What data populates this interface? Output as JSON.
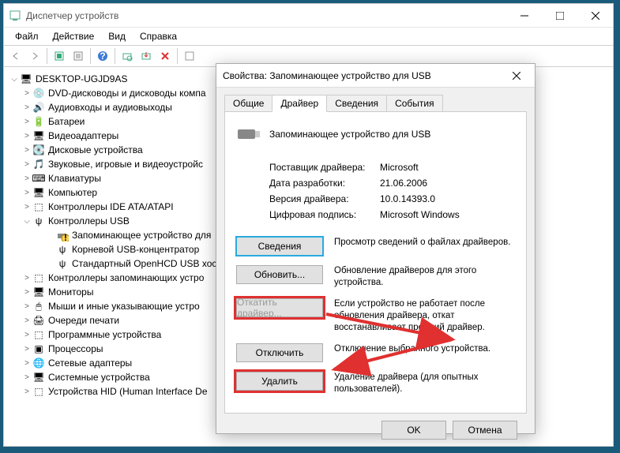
{
  "window": {
    "title": "Диспетчер устройств"
  },
  "menubar": {
    "file": "Файл",
    "action": "Действие",
    "view": "Вид",
    "help": "Справка"
  },
  "tree": {
    "root": "DESKTOP-UGJD9AS",
    "items": [
      "DVD-дисководы и дисководы компа",
      "Аудиовходы и аудиовыходы",
      "Батареи",
      "Видеоадаптеры",
      "Дисковые устройства",
      "Звуковые, игровые и видеоустройс",
      "Клавиатуры",
      "Компьютер",
      "Контроллеры IDE ATA/ATAPI",
      "Контроллеры USB",
      "Контроллеры запоминающих устро",
      "Мониторы",
      "Мыши и иные указывающие устро",
      "Очереди печати",
      "Программные устройства",
      "Процессоры",
      "Сетевые адаптеры",
      "Системные устройства",
      "Устройства HID (Human Interface De"
    ],
    "usb_children": [
      "Запоминающее устройство для",
      "Корневой USB-концентратор",
      "Стандартный OpenHCD USB хост"
    ]
  },
  "dialog": {
    "title": "Свойства: Запоминающее устройство для USB",
    "tabs": {
      "general": "Общие",
      "driver": "Драйвер",
      "details": "Сведения",
      "events": "События"
    },
    "device_name": "Запоминающее устройство для USB",
    "info": {
      "provider_k": "Поставщик драйвера:",
      "provider_v": "Microsoft",
      "date_k": "Дата разработки:",
      "date_v": "21.06.2006",
      "version_k": "Версия драйвера:",
      "version_v": "10.0.14393.0",
      "signature_k": "Цифровая подпись:",
      "signature_v": "Microsoft Windows"
    },
    "buttons": {
      "details": "Сведения",
      "update": "Обновить...",
      "rollback": "Откатить драйвер...",
      "disable": "Отключить",
      "uninstall": "Удалить"
    },
    "desc": {
      "details": "Просмотр сведений о файлах драйверов.",
      "update": "Обновление драйверов для этого устройства.",
      "rollback": "Если устройство не работает после обновления драйвера, откат восстанавливает прежний драйвер.",
      "disable": "Отключение выбранного устройства.",
      "uninstall": "Удаление драйвера (для опытных пользователей)."
    },
    "footer": {
      "ok": "OK",
      "cancel": "Отмена"
    }
  },
  "icons": {
    "devmgr": "⚙",
    "dvd": "💿",
    "audio": "🔊",
    "battery": "🔋",
    "video": "🖥",
    "disk": "💽",
    "sound": "🎵",
    "keyboard": "⌨",
    "computer": "🖥",
    "ide": "⬚",
    "usb": "ψ",
    "usb_item": "ψ",
    "storage": "⬚",
    "monitor": "🖥",
    "mouse": "🖱",
    "printer": "🖨",
    "software": "⬚",
    "cpu": "▣",
    "network": "🌐",
    "system": "🖥",
    "hid": "⬚"
  }
}
